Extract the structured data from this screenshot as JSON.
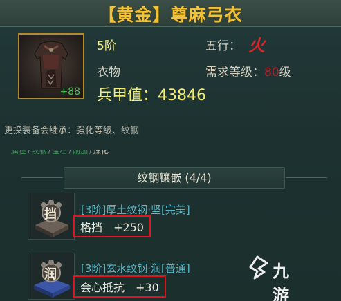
{
  "item": {
    "title": "【黄金】尊麻弓衣",
    "grade": "5阶",
    "kind": "衣物",
    "icon_level": "+88",
    "wuxing_label": "五行：",
    "wuxing_value": "火",
    "req_label": "需求等级：",
    "req_level": "80",
    "req_unit": "级",
    "stat_label": "兵甲值：",
    "stat_value": "43846",
    "inherit_note": "更换装备会继承：强化等级、纹钢"
  },
  "tabs": [
    "属性",
    "纹钢",
    "宝石",
    "附加",
    "炼化"
  ],
  "section": {
    "title": "纹钢镶嵌 (4/4)"
  },
  "gems": [
    {
      "badge": "挡",
      "name": "[3阶]厚土纹钢·坚[完美]",
      "effect_label": "格挡",
      "effect_value": "+250"
    },
    {
      "badge": "润",
      "name": "[3阶]玄水纹钢·润[普通]",
      "effect_label": "会心抵抗",
      "effect_value": "+30"
    }
  ],
  "watermark": {
    "text": "九游"
  },
  "colors": {
    "title": "#f1c233",
    "fire": "#d2262b",
    "stat": "#f4ee76",
    "gem_name": "#59b8c8",
    "highlight_box": "#e0141f"
  }
}
